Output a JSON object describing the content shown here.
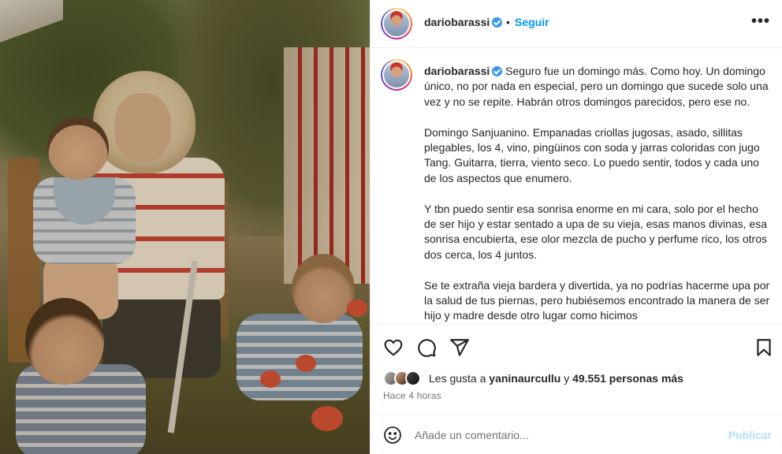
{
  "post": {
    "username": "dariobarassi",
    "follow_label": "Seguir",
    "dot": "•",
    "more_label": "•••"
  },
  "caption": {
    "username": "dariobarassi",
    "paragraphs": [
      "Seguro fue un domingo más. Como hoy. Un domingo único, no por nada en especial, pero un domingo que sucede solo una vez y no se repite. Habrán otros domingos parecidos, pero ese no.",
      "Domingo Sanjuanino. Empanadas criollas jugosas, asado, sillitas plegables, los 4, vino, pingüinos con soda y jarras coloridas con jugo Tang. Guitarra, tierra, viento seco. Lo puedo sentir, todos y cada uno de los aspectos que enumero.",
      "Y tbn puedo sentir esa sonrisa enorme en mi cara, solo por el hecho de ser hijo y estar sentado a upa de su vieja, esas manos divinas, esa sonrisa encubierta, ese olor mezcla de pucho y perfume rico, los otros dos cerca, los 4 juntos.",
      "Se te extraña vieja bardera y divertida, ya no podrías hacerme upa por la salud de tus piernas, pero hubiésemos encontrado la manera de ser hijo y madre desde otro lugar como hicimos"
    ]
  },
  "likes": {
    "prefix": "Les gusta a",
    "first_user": "yaninaurcullu",
    "connector": "y",
    "others": "49.551 personas más"
  },
  "timestamp": "Hace 4 horas",
  "comment": {
    "placeholder": "Añade un comentario...",
    "publish_label": "Publicar"
  },
  "icons": {
    "like": "heart-icon",
    "comment": "comment-icon",
    "share": "share-icon",
    "save": "bookmark-icon",
    "emoji": "emoji-icon",
    "verified": "verified-badge-icon",
    "more": "more-options-icon"
  },
  "colors": {
    "accent": "#0095f6",
    "verified": "#3897f0",
    "text": "#262626",
    "muted": "#737373",
    "publish_disabled": "#b2dffc"
  }
}
